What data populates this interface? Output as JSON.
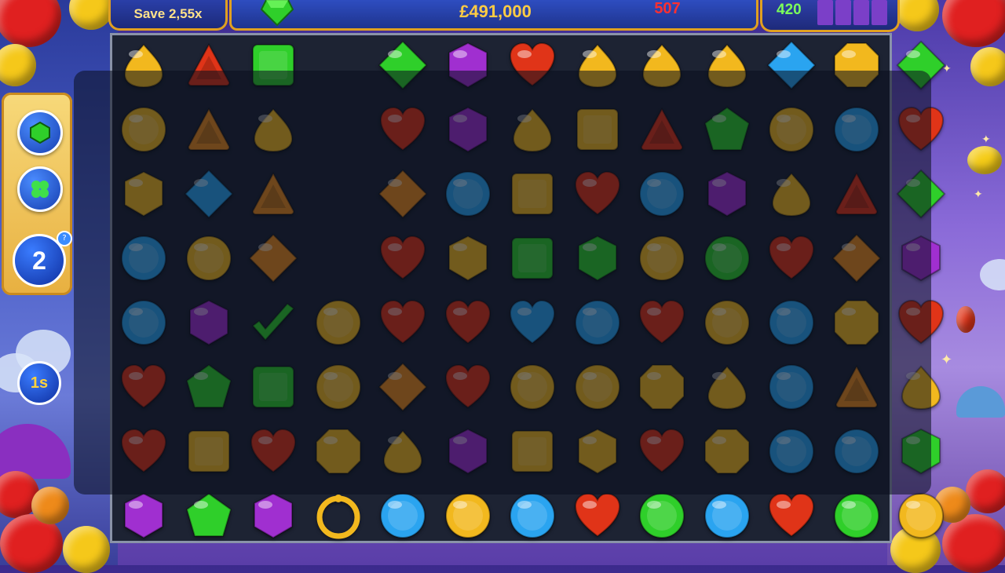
{
  "hud": {
    "save_label": "Save 2,55x",
    "score": "£491,000",
    "moves": "507",
    "target": "420",
    "progress_bars": 4
  },
  "side": {
    "booster_count": "2",
    "booster_badge": "?",
    "timer_label": "1s"
  },
  "colors": {
    "yellow": "#f2b81e",
    "red": "#e03418",
    "green": "#2fcf2a",
    "blue": "#2aa4f0",
    "purple": "#a02fd0",
    "orange": "#e88a1c",
    "darkred": "#c02418"
  },
  "board": {
    "cols": 13,
    "rows": 8,
    "grid": [
      [
        "y-drop",
        "r-tri",
        "g-sq",
        "empty",
        "g-dia",
        "p-hex",
        "r-heart",
        "y-drop",
        "y-drop",
        "y-drop",
        "b-dia",
        "y-oct",
        "g-dia"
      ],
      [
        "y-circ",
        "o-tri",
        "y-drop",
        "empty",
        "r-heart",
        "p-hex",
        "y-drop",
        "y-sq",
        "r-tri",
        "g-pent",
        "y-circ",
        "b-circ",
        "r-heart"
      ],
      [
        "y-hex",
        "b-dia",
        "o-tri",
        "empty",
        "o-dia",
        "b-circ",
        "y-sq",
        "r-heart",
        "b-circ",
        "p-hex",
        "y-drop",
        "r-tri",
        "g-dia"
      ],
      [
        "b-circ",
        "y-circ",
        "o-dia",
        "empty",
        "r-heart",
        "y-hex",
        "g-sq",
        "g-hex",
        "y-circ",
        "g-circ",
        "r-heart",
        "o-dia",
        "p-hex"
      ],
      [
        "b-circ",
        "p-hex",
        "g-check",
        "y-circ",
        "r-heart",
        "r-heart",
        "b-heart",
        "b-circ",
        "r-heart",
        "y-circ",
        "b-circ",
        "y-oct",
        "r-heart"
      ],
      [
        "r-heart",
        "g-pent",
        "g-sq",
        "y-circ",
        "o-dia",
        "r-heart",
        "y-circ",
        "y-circ",
        "y-oct",
        "y-drop",
        "b-circ",
        "o-tri",
        "y-drop"
      ],
      [
        "r-heart",
        "y-sq",
        "r-heart",
        "y-oct",
        "y-drop",
        "p-hex",
        "y-sq",
        "y-hex",
        "r-heart",
        "y-oct",
        "b-circ",
        "b-circ",
        "g-hex"
      ],
      [
        "p-hex",
        "g-pent",
        "p-hex",
        "y-ring",
        "b-circ",
        "y-circ",
        "b-circ",
        "r-heart",
        "g-circ",
        "b-circ",
        "r-heart",
        "g-circ",
        "y-circ"
      ]
    ]
  }
}
